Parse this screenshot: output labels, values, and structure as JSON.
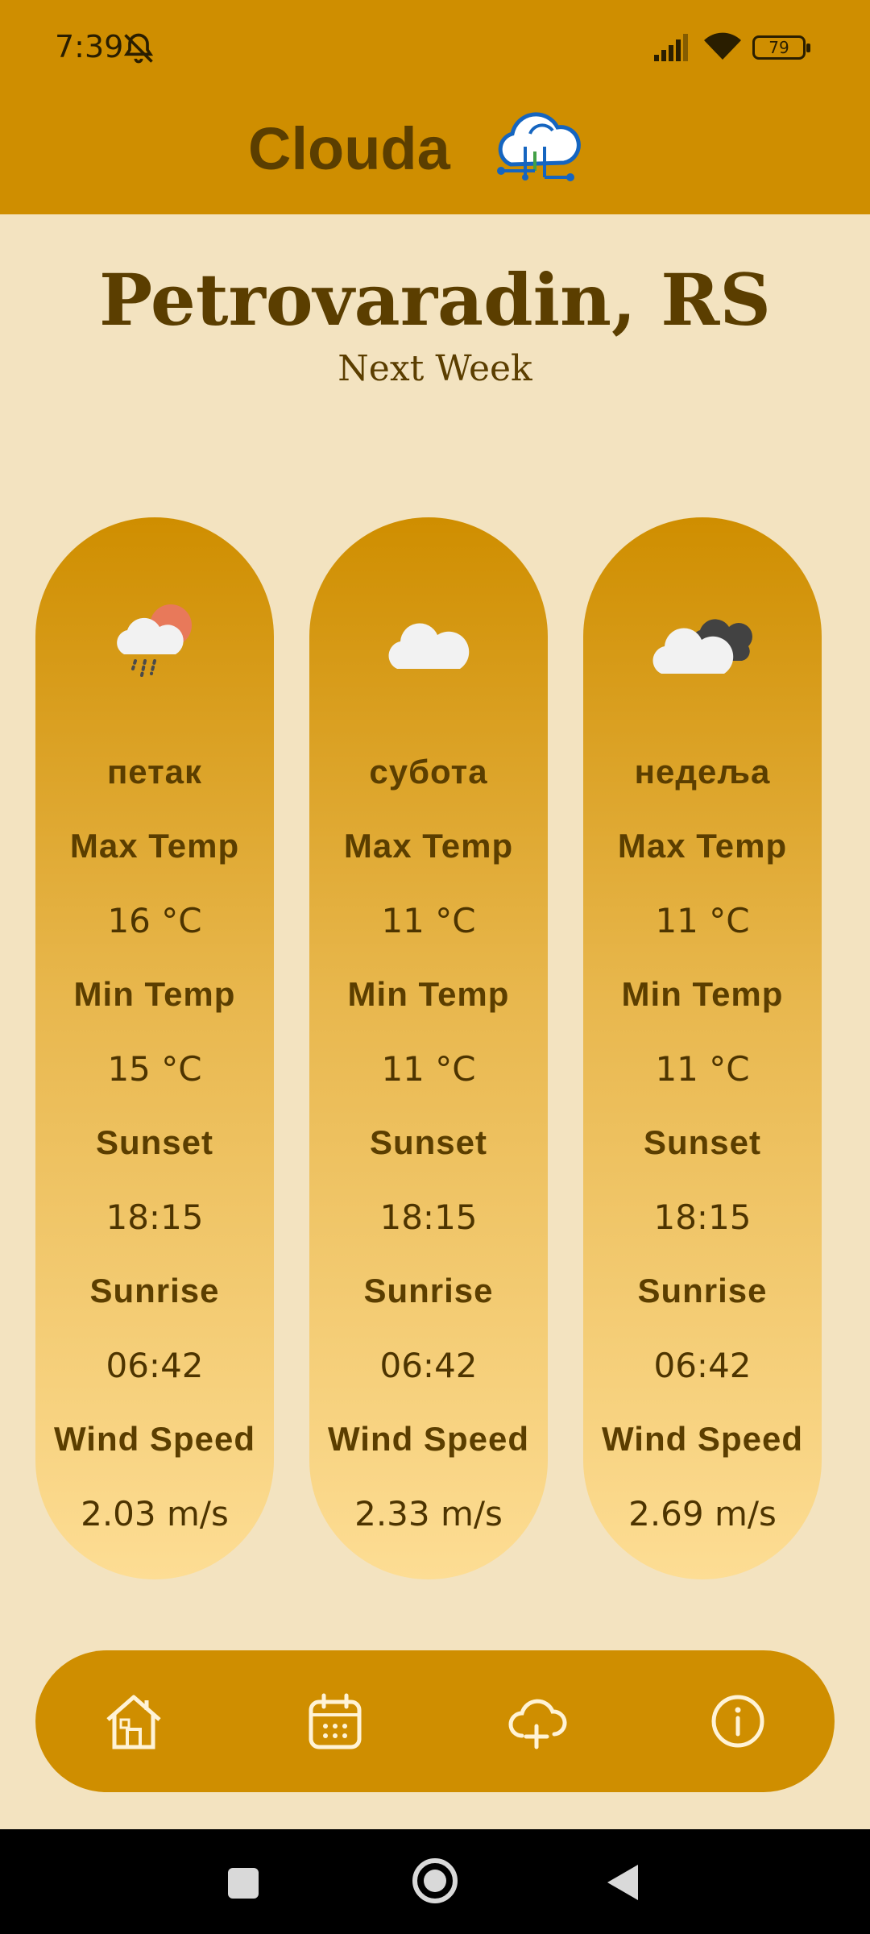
{
  "status_bar": {
    "time": "7:39",
    "battery": "79",
    "icons": [
      "bell-off-icon",
      "signal-icon",
      "wifi-icon",
      "battery-icon"
    ]
  },
  "app": {
    "title": "Clouda",
    "logo_icon": "cloud-circuit-icon"
  },
  "location": {
    "city": "Petrovaradin, RS",
    "subtitle": "Next Week"
  },
  "forecast": [
    {
      "icon": "rain-sun-cloud-icon",
      "day": "петак",
      "max_temp_label": "Max Temp",
      "max_temp": "16 °C",
      "min_temp_label": "Min Temp",
      "min_temp": "15 °C",
      "sunset_label": "Sunset",
      "sunset": "18:15",
      "sunrise_label": "Sunrise",
      "sunrise": "06:42",
      "wind_label": "Wind Speed",
      "wind": "2.03 m/s"
    },
    {
      "icon": "cloud-icon",
      "day": "субота",
      "max_temp_label": "Max Temp",
      "max_temp": "11 °C",
      "min_temp_label": "Min Temp",
      "min_temp": "11 °C",
      "sunset_label": "Sunset",
      "sunset": "18:15",
      "sunrise_label": "Sunrise",
      "sunrise": "06:42",
      "wind_label": "Wind Speed",
      "wind": "2.33 m/s"
    },
    {
      "icon": "dark-clouds-icon",
      "day": "недеља",
      "max_temp_label": "Max Temp",
      "max_temp": "11 °C",
      "min_temp_label": "Min Temp",
      "min_temp": "11 °C",
      "sunset_label": "Sunset",
      "sunset": "18:15",
      "sunrise_label": "Sunrise",
      "sunrise": "06:42",
      "wind_label": "Wind Speed",
      "wind": "2.69 m/s"
    }
  ],
  "bottom_nav": [
    "home-icon",
    "calendar-icon",
    "cloud-add-icon",
    "info-icon"
  ],
  "colors": {
    "primary": "#CF8E00",
    "background": "#F3E3C0",
    "text": "#5B3E00",
    "card_bottom": "#FDDD94"
  }
}
